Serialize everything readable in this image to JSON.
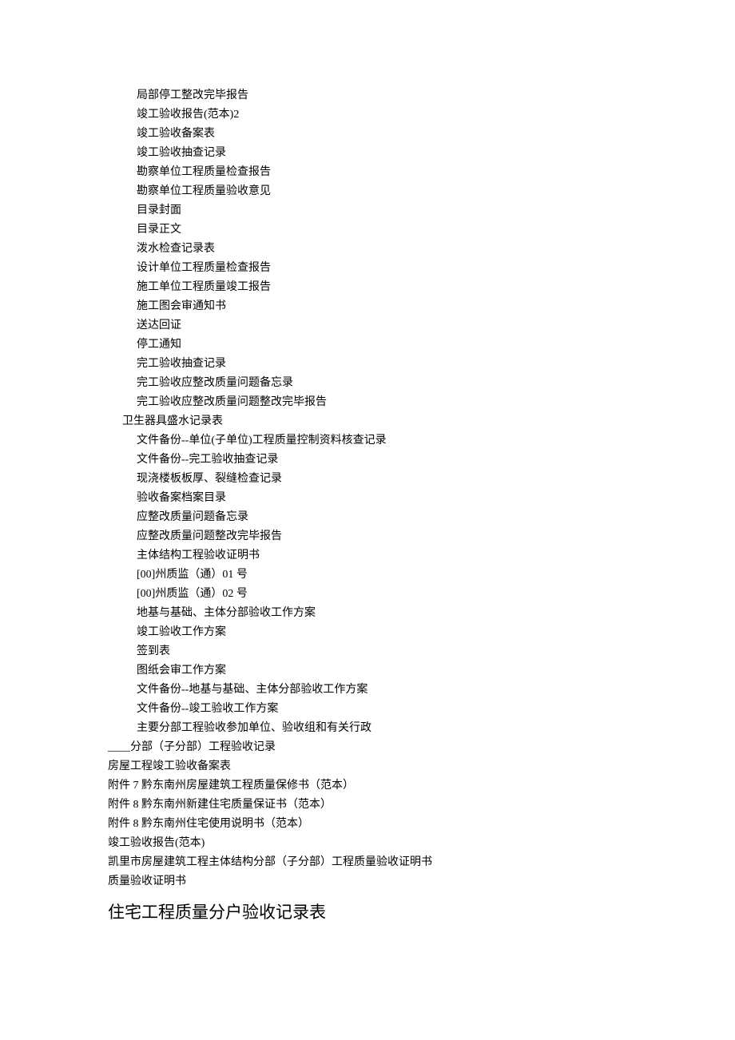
{
  "block_a": [
    "局部停工整改完毕报告",
    "竣工验收报告(范本)2",
    "竣工验收备案表",
    "竣工验收抽查记录",
    "勘察单位工程质量检查报告",
    "勘察单位工程质量验收意见",
    "目录封面",
    "目录正文",
    "泼水检查记录表",
    "设计单位工程质量检查报告",
    "施工单位工程质量竣工报告",
    "施工图会审通知书",
    "送达回证",
    "停工通知",
    "完工验收抽查记录",
    "完工验收应整改质量问题备忘录",
    "完工验收应整改质量问题整改完毕报告"
  ],
  "block_b": [
    "卫生器具盛水记录表"
  ],
  "block_c": [
    "文件备份--单位(子单位)工程质量控制资料核查记录",
    "文件备份--完工验收抽查记录",
    "现浇楼板板厚、裂缝检查记录",
    "验收备案档案目录",
    "应整改质量问题备忘录",
    "应整改质量问题整改完毕报告",
    "主体结构工程验收证明书",
    "[00]州质监（通）01 号",
    "[00]州质监（通）02 号",
    "地基与基础、主体分部验收工作方案",
    "竣工验收工作方案",
    "签到表",
    "图纸会审工作方案",
    "文件备份--地基与基础、主体分部验收工作方案",
    "文件备份--竣工验收工作方案",
    "主要分部工程验收参加单位、验收组和有关行政"
  ],
  "block_d": [
    "____分部（子分部）工程验收记录",
    "房屋工程竣工验收备案表",
    "附件 7 黔东南州房屋建筑工程质量保修书（范本）",
    "附件 8 黔东南州新建住宅质量保证书（范本）",
    "附件 8 黔东南州住宅使用说明书（范本）",
    "竣工验收报告(范本)",
    "凯里市房屋建筑工程主体结构分部（子分部）工程质量验收证明书",
    "质量验收证明书"
  ],
  "heading": "住宅工程质量分户验收记录表"
}
